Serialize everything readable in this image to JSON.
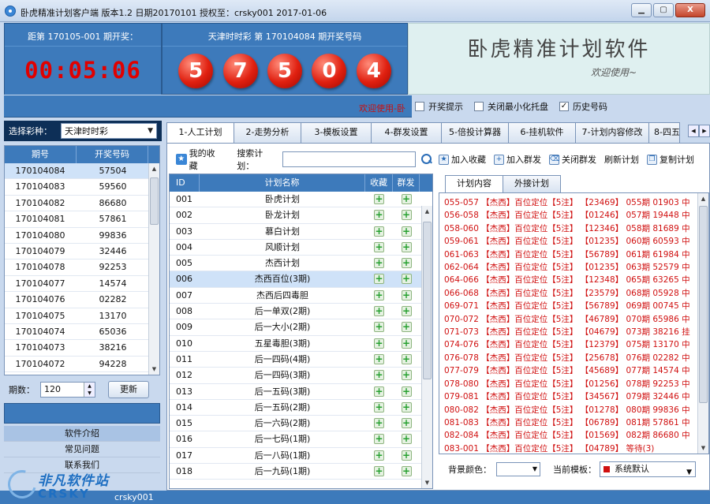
{
  "window": {
    "title": "卧虎精准计划客户端   版本1.2  日期20170101     授权至：crsky001   2017-01-06",
    "buttons": [
      "▁",
      "▢",
      "X"
    ]
  },
  "countdown": {
    "label": "距第 170105-001 期开奖：",
    "time": "00:05:06"
  },
  "draw": {
    "label": "天津时时彩 第 170104084 期开奖号码",
    "balls": [
      "5",
      "7",
      "5",
      "0",
      "4"
    ]
  },
  "brand": {
    "title": "卧虎精准计划软件",
    "subtitle": "欢迎使用~"
  },
  "status": {
    "welcome": "欢迎使用-卧",
    "options": [
      {
        "label": "开奖提示",
        "checked": false
      },
      {
        "label": "关闭最小化托盘",
        "checked": false
      },
      {
        "label": "历史号码",
        "checked": true
      }
    ]
  },
  "lottery_select": {
    "label": "选择彩种：",
    "value": "天津时时彩"
  },
  "history": {
    "headers": [
      "期号",
      "开奖号码"
    ],
    "rows": [
      [
        "170104084",
        "57504"
      ],
      [
        "170104083",
        "59560"
      ],
      [
        "170104082",
        "86680"
      ],
      [
        "170104081",
        "57861"
      ],
      [
        "170104080",
        "99836"
      ],
      [
        "170104079",
        "32446"
      ],
      [
        "170104078",
        "92253"
      ],
      [
        "170104077",
        "14574"
      ],
      [
        "170104076",
        "02282"
      ],
      [
        "170104075",
        "13170"
      ],
      [
        "170104074",
        "65036"
      ],
      [
        "170104073",
        "38216"
      ],
      [
        "170104072",
        "94228"
      ]
    ]
  },
  "periods": {
    "label": "期数：",
    "value": "120",
    "refresh_label": "更新"
  },
  "left_nav": {
    "items": [
      "软件介绍",
      "常见问题",
      "联系我们"
    ]
  },
  "tabs": [
    "1-人工计划",
    "2-走势分析",
    "3-模板设置",
    "4-群发设置",
    "5-倍投计算器",
    "6-挂机软件",
    "7-计划内容修改",
    "8-四五"
  ],
  "plan_list": {
    "fav_label": "我的收藏",
    "search_label": "搜索计划：",
    "search_value": "",
    "headers": [
      "ID",
      "计划名称",
      "收藏",
      "群发"
    ],
    "rows": [
      [
        "001",
        "卧虎计划"
      ],
      [
        "002",
        "卧龙计划"
      ],
      [
        "003",
        "慕白计划"
      ],
      [
        "004",
        "风顺计划"
      ],
      [
        "005",
        "杰西计划"
      ],
      [
        "006",
        "杰西百位(3期)"
      ],
      [
        "007",
        "杰西后四毒胆"
      ],
      [
        "008",
        "后一单双(2期)"
      ],
      [
        "009",
        "后一大小(2期)"
      ],
      [
        "010",
        "五星毒胆(3期)"
      ],
      [
        "011",
        "后一四码(4期)"
      ],
      [
        "012",
        "后一四码(3期)"
      ],
      [
        "013",
        "后一五码(3期)"
      ],
      [
        "014",
        "后一五码(2期)"
      ],
      [
        "015",
        "后一六码(2期)"
      ],
      [
        "016",
        "后一七码(1期)"
      ],
      [
        "017",
        "后一八码(1期)"
      ],
      [
        "018",
        "后一九码(1期)"
      ]
    ]
  },
  "plan_toolbar": [
    "加入收藏",
    "加入群发",
    "关闭群发",
    "刷新计划",
    "复制计划"
  ],
  "plan_subtabs": [
    "计划内容",
    "外接计划"
  ],
  "plan_content": [
    "055-057 【杰西】百位定位【5注】 【23469】 055期 01903 中",
    "056-058 【杰西】百位定位【5注】 【01246】 057期 19448 中",
    "058-060 【杰西】百位定位【5注】 【12346】 058期 81689 中",
    "059-061 【杰西】百位定位【5注】 【01235】 060期 60593 中",
    "061-063 【杰西】百位定位【5注】 【56789】 061期 61984 中",
    "062-064 【杰西】百位定位【5注】 【01235】 063期 52579 中",
    "064-066 【杰西】百位定位【5注】 【12348】 065期 63265 中",
    "066-068 【杰西】百位定位【5注】 【23579】 068期 05928 中",
    "069-071 【杰西】百位定位【5注】 【56789】 069期 00745 中",
    "070-072 【杰西】百位定位【5注】 【46789】 070期 65986 中",
    "071-073 【杰西】百位定位【5注】 【04679】 073期 38216 挂",
    "074-076 【杰西】百位定位【5注】 【12379】 075期 13170 中",
    "076-078 【杰西】百位定位【5注】 【25678】 076期 02282 中",
    "077-079 【杰西】百位定位【5注】 【45689】 077期 14574 中",
    "078-080 【杰西】百位定位【5注】 【01256】 078期 92253 中",
    "079-081 【杰西】百位定位【5注】 【34567】 079期 32446 中",
    "080-082 【杰西】百位定位【5注】 【01278】 080期 99836 中",
    "081-083 【杰西】百位定位【5注】 【06789】 081期 57861 中",
    "082-084 【杰西】百位定位【5注】 【01569】 082期 86680 中",
    "083-001 【杰西】百位定位【5注】 【04789】 等待(3)"
  ],
  "plan_separator": "------------------------------------------------",
  "bottom_controls": {
    "bg_label": "背景颜色：",
    "template_label": "当前模板：",
    "template_value": "系统默认"
  },
  "bottom_bar": {
    "user": "crsky001"
  },
  "watermark": {
    "line1": "非凡软件站",
    "line2": "CRSKY"
  }
}
